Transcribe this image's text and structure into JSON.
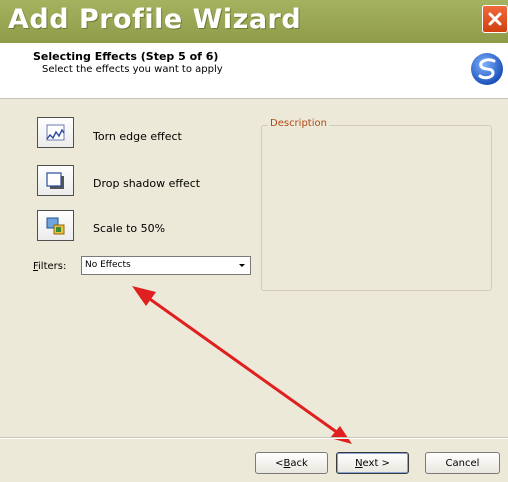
{
  "window": {
    "title": "Add Profile Wizard"
  },
  "header": {
    "step_title": "Selecting Effects (Step 5 of 6)",
    "step_subtitle": "Select the effects you want to apply"
  },
  "effects": [
    {
      "label": "Torn edge effect",
      "icon": "torn-edge-icon"
    },
    {
      "label": "Drop shadow effect",
      "icon": "drop-shadow-icon"
    },
    {
      "label": "Scale to 50%",
      "icon": "scale-icon"
    }
  ],
  "filters": {
    "label": "Filters:",
    "accesskey": "F",
    "label_rest": "ilters:",
    "value": "No Effects"
  },
  "description": {
    "legend": "Description"
  },
  "buttons": {
    "back": {
      "prefix": "< ",
      "key": "B",
      "rest": "ack"
    },
    "next": {
      "key": "N",
      "rest": "ext >"
    },
    "cancel": "Cancel"
  },
  "colors": {
    "title_bar": "#a5b25f",
    "close": "#e0531f",
    "annotation_arrow": "#e02020",
    "legend_text": "#b04a15"
  }
}
